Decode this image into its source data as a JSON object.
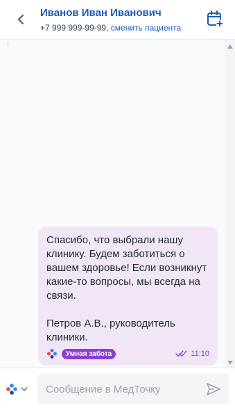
{
  "header": {
    "patient_name": "Иванов Иван Иванович",
    "phone": "+7 999 999-99-99,",
    "change_patient": "сменить пациента"
  },
  "message": {
    "text": "Спасибо, что выбрали нашу клинику. Будем заботиться о вашем здоровье! Если возникнут какие-то вопросы, мы всегда на связи.\n\nПетров А.В., руководитель клиники.",
    "badge": "Умная забота",
    "time": "11:10",
    "status_icon": "double-check-icon"
  },
  "composer": {
    "placeholder": "Сообщение в МедТочку",
    "channel_icon": "medtochka-logo-icon",
    "send_icon": "send-icon"
  },
  "colors": {
    "accent": "#1e5bb8",
    "bubble": "#f1e6f5",
    "badge": "#8b3fd1",
    "time": "#7c3aed"
  }
}
